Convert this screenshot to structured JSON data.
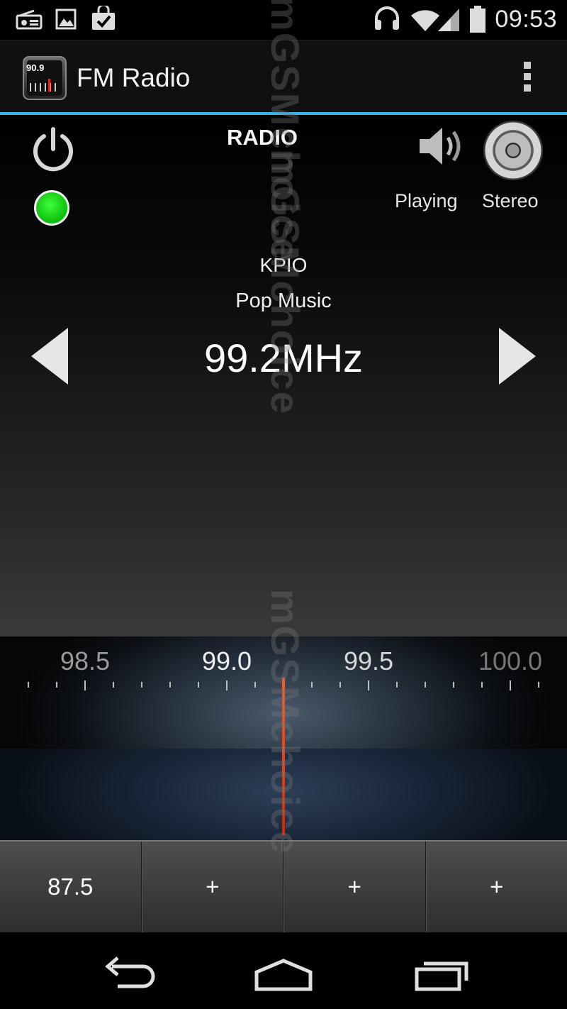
{
  "status_bar": {
    "time": "09:53",
    "left_icons": [
      "radio-icon",
      "image-icon",
      "shopping-bag-icon"
    ],
    "right_icons": [
      "headphones-icon",
      "wifi-icon",
      "signal-icon",
      "battery-icon"
    ]
  },
  "action_bar": {
    "app_icon_text": "90.9",
    "title": "FM Radio",
    "overflow_icon": "overflow-menu-icon",
    "accent_color": "#33b5e5"
  },
  "main": {
    "radio_label": "RADIO",
    "power_icon": "power-icon",
    "status_indicator_color": "#18d418",
    "playing_label": "Playing",
    "stereo_label": "Stereo",
    "station_name": "KPIO",
    "station_genre": "Pop Music",
    "frequency": "99.2MHz"
  },
  "dial": {
    "tick_labels": [
      "98.5",
      "99.0",
      "99.5",
      "100.0"
    ],
    "needle_color": "#e83a0c"
  },
  "presets": [
    "87.5",
    "+",
    "+",
    "+"
  ],
  "watermark": [
    "mGSMchoice",
    "mGSMchoice",
    "mGSMchoice"
  ]
}
